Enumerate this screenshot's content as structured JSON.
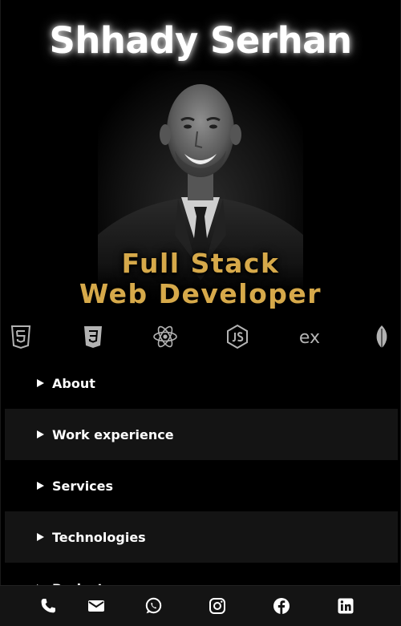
{
  "header": {
    "name": "Shhady Serhan",
    "role_line1": "Full Stack",
    "role_line2": "Web Developer"
  },
  "technologies": [
    {
      "icon": "html5-icon"
    },
    {
      "icon": "css3-icon"
    },
    {
      "icon": "react-icon"
    },
    {
      "icon": "nodejs-icon"
    },
    {
      "icon": "express-icon",
      "label": "ex"
    },
    {
      "icon": "mongodb-icon"
    }
  ],
  "sections": [
    {
      "label": "About"
    },
    {
      "label": "Work experience"
    },
    {
      "label": "Services"
    },
    {
      "label": "Technologies"
    },
    {
      "label": "Projects"
    }
  ],
  "contact_bar": [
    "phone-icon",
    "email-icon",
    "whatsapp-icon",
    "instagram-icon",
    "facebook-icon",
    "linkedin-icon"
  ],
  "colors": {
    "background": "#000000",
    "accent_gold": "#d6a94a",
    "section_shade": "#141414",
    "icon_gray": "#b3b3b3"
  }
}
